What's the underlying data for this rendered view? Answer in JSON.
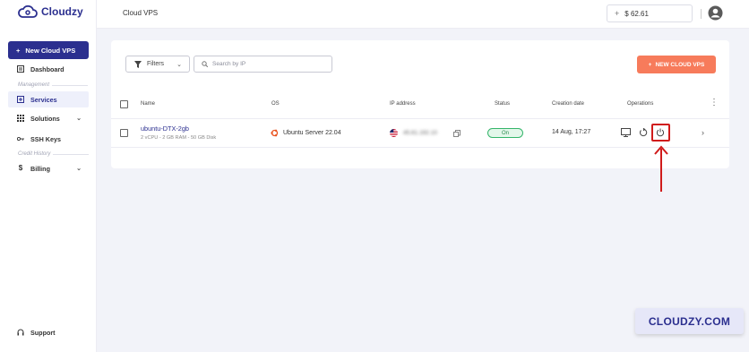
{
  "brand": {
    "name": "Cloudzy",
    "color": "#2b2f8f"
  },
  "sidebar": {
    "new_vps_label": "New Cloud VPS",
    "dashboard_label": "Dashboard",
    "section_management": "Management",
    "services_label": "Services",
    "solutions_label": "Solutions",
    "ssh_keys_label": "SSH Keys",
    "section_credit": "Credit History",
    "billing_label": "Billing",
    "support_label": "Support"
  },
  "header": {
    "title": "Cloud VPS",
    "balance_plus": "+",
    "balance": "$ 62.61"
  },
  "toolbar": {
    "filters_label": "Filters",
    "search_placeholder": "Search by IP",
    "new_cloud_vps_label": "NEW CLOUD VPS",
    "new_cloud_vps_color": "#f77b5b"
  },
  "table": {
    "columns": [
      "Name",
      "OS",
      "IP address",
      "Status",
      "Creation date",
      "Operations"
    ],
    "rows": [
      {
        "name": "ubuntu-DTX-2gb",
        "spec": "2 vCPU - 2 GB RAM - 50 GB Disk",
        "os": "Ubuntu Server 22.04",
        "ip": "45.61.192.10",
        "status": "On",
        "status_color": "#34b56a",
        "created": "14 Aug, 17:27"
      }
    ]
  },
  "annotation": {
    "highlight_color": "#d01b1b",
    "target": "power-icon"
  },
  "watermark": "CLOUDZY.COM"
}
